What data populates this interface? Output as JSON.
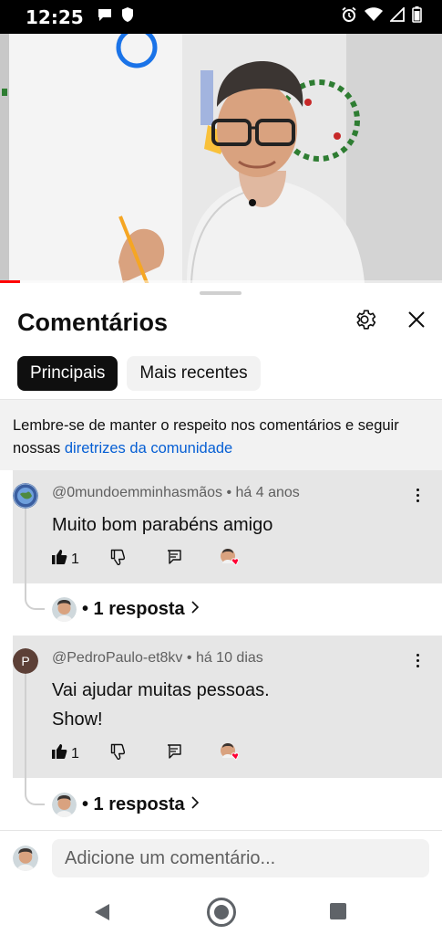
{
  "status_bar": {
    "time": "12:25"
  },
  "sheet": {
    "title": "Comentários",
    "chips": [
      "Principais",
      "Mais recentes"
    ],
    "notice_text": "Lembre-se de manter o respeito nos comentários e seguir nossas ",
    "notice_link": "diretrizes da comunidade"
  },
  "comments": [
    {
      "author": "@0mundoemminhasmãos",
      "time": "há 4 anos",
      "text": "Muito bom parabéns amigo",
      "likes": "1",
      "replies": "• 1 resposta",
      "avatar_color": "#3a5ea0"
    },
    {
      "author": "@PedroPaulo-et8kv",
      "time": "há 10 dias",
      "text_line1": "Vai ajudar muitas pessoas.",
      "text_line2": "Show!",
      "likes": "1",
      "replies": "• 1 resposta",
      "avatar_letter": "P",
      "avatar_color": "#5d4037"
    }
  ],
  "add_comment": {
    "placeholder": "Adicione um comentário..."
  },
  "colors": {
    "link": "#065fd4",
    "heart": "#ff0033",
    "progress": "#ff0000"
  }
}
